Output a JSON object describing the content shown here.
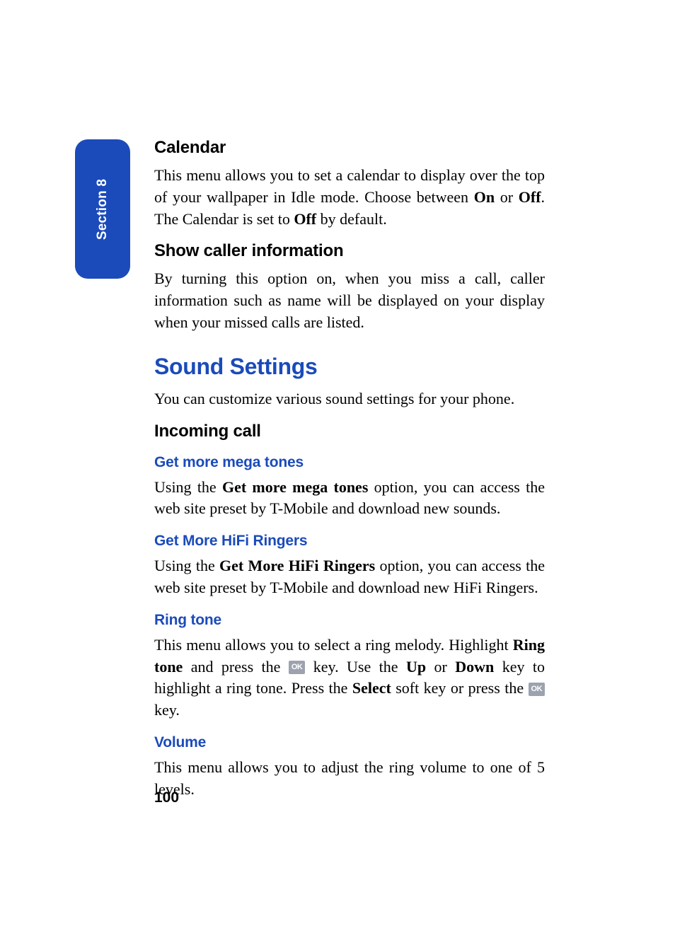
{
  "sectionTab": "Section 8",
  "pageNumber": "100",
  "okKeyLabel": "OK",
  "calendar": {
    "heading": "Calendar",
    "p1_a": "This menu allows you to set a calendar to display over the top of your wallpaper in Idle mode. Choose between ",
    "p1_on": "On",
    "p1_b": " or ",
    "p1_off": "Off",
    "p1_c": ". The Calendar is set to ",
    "p1_off2": "Off",
    "p1_d": " by default."
  },
  "showCaller": {
    "heading": "Show caller information",
    "p1": "By turning this option on, when you miss a call, caller information such as name will be displayed on your display when your missed calls are listed."
  },
  "soundSettings": {
    "heading": "Sound Settings",
    "intro": "You can customize various sound settings for your phone."
  },
  "incomingCall": {
    "heading": "Incoming call"
  },
  "megaTones": {
    "heading": "Get more mega tones",
    "p1_a": "Using the ",
    "p1_bold": "Get more mega tones",
    "p1_b": " option, you can access the web site preset by T-Mobile and download new sounds."
  },
  "hifiRingers": {
    "heading": "Get More HiFi Ringers",
    "p1_a": "Using the ",
    "p1_bold": "Get More HiFi Ringers",
    "p1_b": " option, you can access the web site preset by T-Mobile and download new HiFi Ringers."
  },
  "ringTone": {
    "heading": "Ring tone",
    "p1_a": "This menu allows you to select a ring melody. Highlight ",
    "p1_bold1": "Ring tone",
    "p1_b": " and press the ",
    "p1_c": " key. Use the ",
    "p1_bold2": "Up",
    "p1_d": " or ",
    "p1_bold3": "Down",
    "p1_e": " key to highlight a ring tone. Press the ",
    "p1_bold4": "Select",
    "p1_f": " soft key or press the ",
    "p1_g": " key."
  },
  "volume": {
    "heading": "Volume",
    "p1": "This menu allows you to adjust the ring volume to one of 5 levels."
  }
}
